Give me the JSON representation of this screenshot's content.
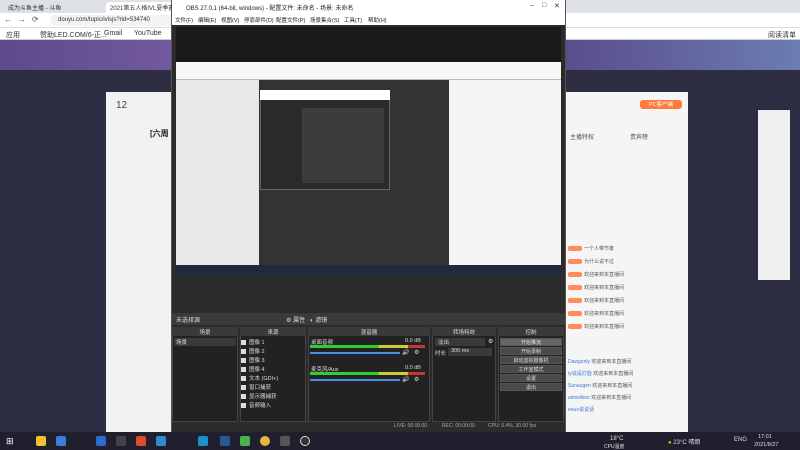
{
  "browser": {
    "tabs": [
      {
        "label": "成为斗鱼主播 - 斗鱼"
      },
      {
        "label": "2021第五人格IVL夏季赛"
      }
    ],
    "address": "douyu.com/topic/ivlsjs?rid=534740",
    "bookmarks": [
      "应用",
      "赞助LED.COM/6-正...",
      "Gmail",
      "YouTube"
    ],
    "reading_list": "阅读清单"
  },
  "page": {
    "room_counter": "12",
    "side_title": "[六周",
    "fans_label": "PC客户端",
    "chat_tabs": [
      "主播特权",
      "贵宾榜"
    ],
    "chat_lines": [
      "一个人带节奏",
      "为什么说不过",
      "欢迎来到本直播间",
      "欢迎来到本直播间",
      "欢迎来到本直播间",
      "欢迎来到本直播间",
      "欢迎来到本直播间"
    ],
    "chat_users": [
      "Dawgonly",
      "ty说是打脸",
      "Sunaugen",
      "aimedkon",
      "eeuo说说话"
    ],
    "chat_msg": "欢迎来到本直播间"
  },
  "obs": {
    "title": "OBS 27.0.1 (64-bit, windows) - 配置文件: 未命名 - 场景: 未命名",
    "menu": [
      "文件(F)",
      "编辑(E)",
      "视图(V)",
      "停靠部件(D)",
      "配置文件(P)",
      "场景集合(S)",
      "工具(T)",
      "帮助(H)"
    ],
    "no_source": "未选择源",
    "props_label": "属性",
    "filters_label": "滤镜",
    "docks": {
      "scenes": "场景",
      "sources": "来源",
      "mixer": "混音器",
      "transitions": "转场特效",
      "controls": "控制"
    },
    "scene_item": "场景",
    "sources": [
      {
        "name": "图像 1",
        "icon": "image-icon"
      },
      {
        "name": "图像 2",
        "icon": "image-icon"
      },
      {
        "name": "图像 3",
        "icon": "image-icon"
      },
      {
        "name": "图像 4",
        "icon": "image-icon"
      },
      {
        "name": "文本 (GDI+)",
        "icon": "text-icon"
      },
      {
        "name": "窗口捕获",
        "icon": "window-icon"
      },
      {
        "name": "显示器捕获",
        "icon": "monitor-icon"
      },
      {
        "name": "音频输入",
        "icon": "mic-icon"
      }
    ],
    "mixer": [
      {
        "name": "桌面音频",
        "db": "0.0 dB"
      },
      {
        "name": "麦克风/Aux",
        "db": "0.0 dB"
      }
    ],
    "transition": {
      "type": "淡出",
      "duration_label": "时长",
      "duration": "300 ms"
    },
    "controls": [
      "开始推流",
      "开始录制",
      "启动虚拟摄像机",
      "工作室模式",
      "设置",
      "退出"
    ],
    "status": {
      "live": "LIVE: 00:00:00",
      "rec": "REC: 00:00:00",
      "cpu": "CPU: 0.4%, 30.00 fps"
    }
  },
  "taskbar": {
    "weather": "18°C",
    "weather_sub": "CPU温度",
    "temp": "23°C 晴朗",
    "lang": "ENG",
    "time": "17:01",
    "date": "2021/8/27"
  }
}
